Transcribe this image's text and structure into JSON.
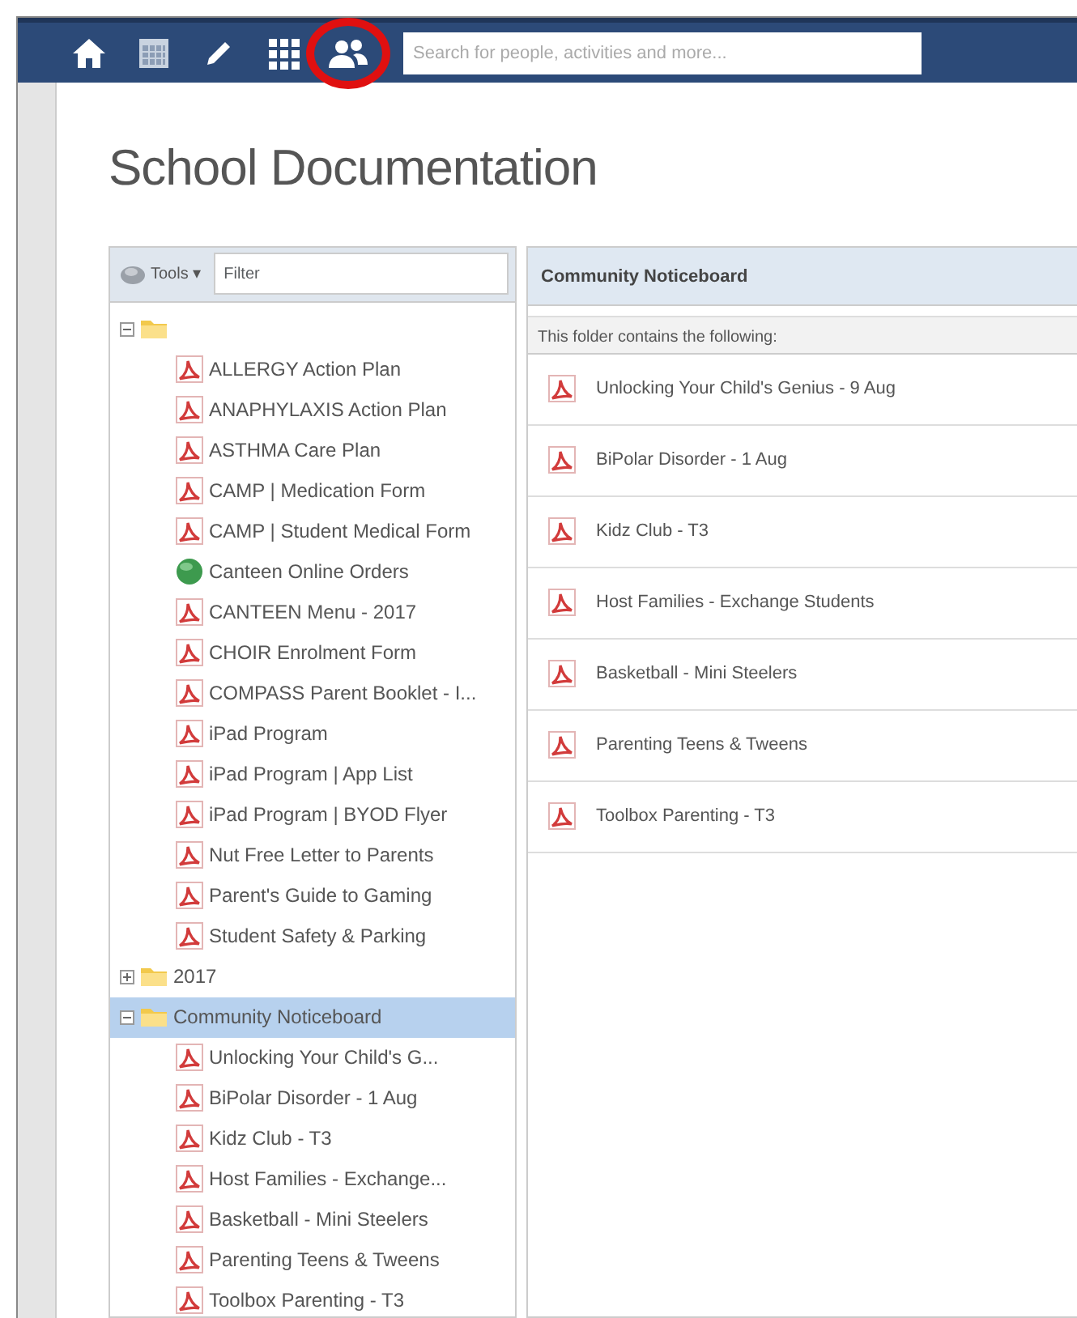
{
  "toolbar": {
    "icons": [
      {
        "kind": "home",
        "highlighted": false
      },
      {
        "kind": "calendar",
        "highlighted": false
      },
      {
        "kind": "pencil",
        "highlighted": false
      },
      {
        "kind": "grid",
        "highlighted": false
      },
      {
        "kind": "people",
        "highlighted": true
      }
    ],
    "search": {
      "placeholder": "Search for people, activities and more..."
    }
  },
  "page_title": "School Documentation",
  "tree_panel": {
    "tools_button": "Tools",
    "caret": "▾",
    "filter": {
      "placeholder": "Filter"
    },
    "tree": [
      {
        "kind": "folder",
        "expanded": true,
        "selected": false,
        "children": [
          {
            "kind": "pdf",
            "label": "ALLERGY Action Plan"
          },
          {
            "kind": "pdf",
            "label": "ANAPHYLAXIS Action Plan"
          },
          {
            "kind": "pdf",
            "label": "ASTHMA Care Plan"
          },
          {
            "kind": "pdf",
            "label": "CAMP | Medication Form"
          },
          {
            "kind": "pdf",
            "label": "CAMP | Student Medical Form"
          },
          {
            "kind": "web",
            "label": "Canteen Online Orders"
          },
          {
            "kind": "pdf",
            "label": "CANTEEN Menu - 2017"
          },
          {
            "kind": "pdf",
            "label": "CHOIR Enrolment Form"
          },
          {
            "kind": "pdf",
            "label": "COMPASS Parent Booklet - I..."
          },
          {
            "kind": "pdf",
            "label": "iPad Program"
          },
          {
            "kind": "pdf",
            "label": "iPad Program | App List"
          },
          {
            "kind": "pdf",
            "label": "iPad Program | BYOD Flyer"
          },
          {
            "kind": "pdf",
            "label": "Nut Free Letter to Parents"
          },
          {
            "kind": "pdf",
            "label": "Parent's Guide to Gaming"
          },
          {
            "kind": "pdf",
            "label": "Student Safety & Parking"
          }
        ]
      },
      {
        "kind": "folder",
        "label": "2017",
        "expanded": false,
        "selected": false
      },
      {
        "kind": "folder",
        "label": "Community Noticeboard",
        "expanded": true,
        "selected": true,
        "children": [
          {
            "kind": "pdf",
            "label": "Unlocking Your Child's G..."
          },
          {
            "kind": "pdf",
            "label": "BiPolar Disorder - 1 Aug"
          },
          {
            "kind": "pdf",
            "label": "Kidz Club - T3"
          },
          {
            "kind": "pdf",
            "label": "Host Families - Exchange..."
          },
          {
            "kind": "pdf",
            "label": "Basketball - Mini Steelers"
          },
          {
            "kind": "pdf",
            "label": "Parenting Teens & Tweens"
          },
          {
            "kind": "pdf",
            "label": "Toolbox Parenting - T3"
          }
        ]
      }
    ]
  },
  "content_panel": {
    "header": "Community Noticeboard",
    "subheader": "This folder contains the following:",
    "items": [
      {
        "kind": "pdf",
        "label": "Unlocking Your Child's Genius - 9 Aug"
      },
      {
        "kind": "pdf",
        "label": "BiPolar Disorder - 1 Aug"
      },
      {
        "kind": "pdf",
        "label": "Kidz Club - T3"
      },
      {
        "kind": "pdf",
        "label": "Host Families - Exchange Students"
      },
      {
        "kind": "pdf",
        "label": "Basketball - Mini Steelers"
      },
      {
        "kind": "pdf",
        "label": "Parenting Teens & Tweens"
      },
      {
        "kind": "pdf",
        "label": "Toolbox Parenting - T3"
      }
    ]
  }
}
